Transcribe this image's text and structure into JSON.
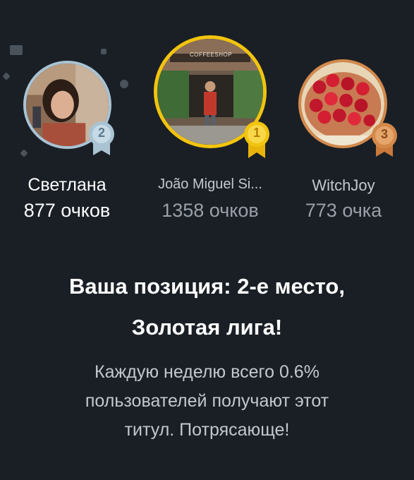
{
  "leaderboard": {
    "players": [
      {
        "rank": "2",
        "name": "Светлана",
        "points": "877 очков",
        "medal": "silver-medal-icon"
      },
      {
        "rank": "1",
        "name": "João Miguel Si...",
        "points": "1358 очков",
        "medal": "gold-medal-icon"
      },
      {
        "rank": "3",
        "name": "WitchJoy",
        "points": "773 очка",
        "medal": "bronze-medal-icon"
      }
    ],
    "shop_sign": "COFFEESHOP"
  },
  "result": {
    "headline_line1": "Ваша позиция: 2-е место,",
    "headline_line2": "Золотая лига!",
    "description_line1": "Каждую неделю всего 0.6%",
    "description_line2": "пользователей получают этот",
    "description_line3": "титул. Потрясающе!"
  },
  "colors": {
    "background": "#1a1f26",
    "gold": "#f2c40f",
    "silver": "#a9c3d3",
    "bronze": "#d4894a"
  }
}
